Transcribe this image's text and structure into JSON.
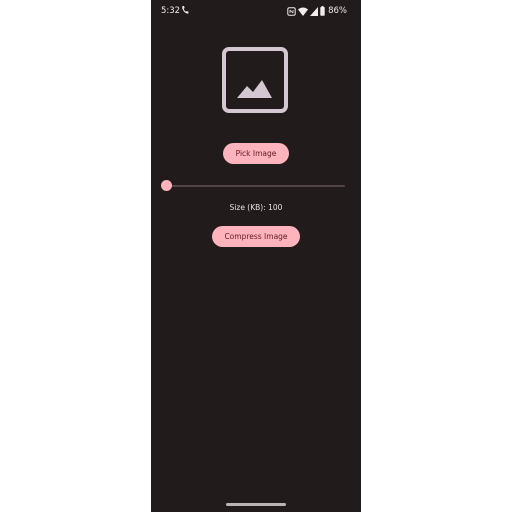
{
  "status_bar": {
    "time": "5:32",
    "battery": "86%",
    "icons": [
      "phone-icon",
      "nfc-icon",
      "wifi-icon",
      "signal-icon",
      "battery-icon"
    ]
  },
  "image_placeholder": {
    "icon": "image-icon"
  },
  "pick_button": {
    "label": "Pick Image"
  },
  "slider": {
    "value": 0,
    "min": 0,
    "max": 1
  },
  "size_label": {
    "text": "Size (KB): 100"
  },
  "compress_button": {
    "label": "Compress Image"
  },
  "colors": {
    "background": "#211b1b",
    "accent": "#ffb3bd",
    "accent_text": "#5f1a24",
    "text": "#e9dfdf"
  }
}
